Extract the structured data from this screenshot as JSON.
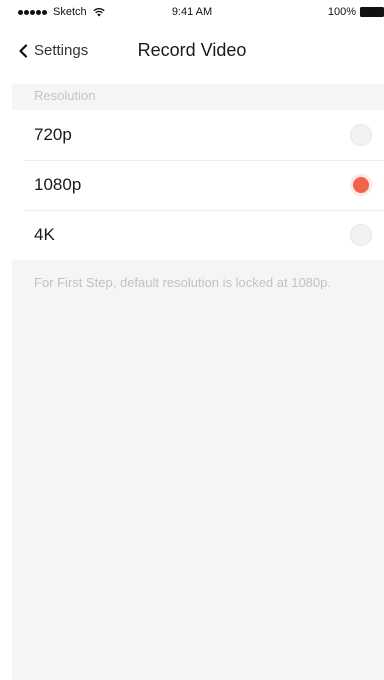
{
  "status_bar": {
    "carrier": "Sketch",
    "time": "9:41 AM",
    "battery": "100%"
  },
  "nav": {
    "back_label": "Settings",
    "title": "Record Video"
  },
  "section": {
    "header": "Resolution"
  },
  "options": [
    {
      "label": "720p",
      "selected": false
    },
    {
      "label": "1080p",
      "selected": true
    },
    {
      "label": "4K",
      "selected": false
    }
  ],
  "footnote": "For First Step, default resolution is locked at 1080p.",
  "colors": {
    "accent": "#f1634d",
    "background": "#f5f5f5",
    "section_text": "#c4c4c4"
  },
  "icons": {
    "back": "chevron-left-icon",
    "wifi": "wifi-icon",
    "battery": "battery-icon"
  }
}
